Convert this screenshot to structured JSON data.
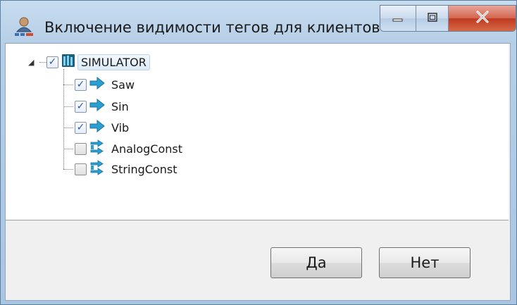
{
  "window": {
    "title": "Включение видимости тегов для клиентов",
    "app_icon": "user-network-icon",
    "controls": {
      "minimize_icon": "minimize-icon",
      "maximize_icon": "maximize-icon",
      "close_icon": "close-icon"
    }
  },
  "tree": {
    "root": {
      "label": "SIMULATOR",
      "checked": true,
      "expanded": true,
      "icon": "server-icon"
    },
    "items": [
      {
        "label": "Saw",
        "checked": true,
        "icon": "arrow-right-icon"
      },
      {
        "label": "Sin",
        "checked": true,
        "icon": "arrow-right-icon"
      },
      {
        "label": "Vib",
        "checked": true,
        "icon": "arrow-right-icon"
      },
      {
        "label": "AnalogConst",
        "checked": false,
        "icon": "double-arrow-icon"
      },
      {
        "label": "StringConst",
        "checked": false,
        "icon": "double-arrow-icon"
      }
    ]
  },
  "buttons": {
    "yes_label": "Да",
    "no_label": "Нет"
  },
  "colors": {
    "frame": "#b6cfe7",
    "close_button": "#c0391f",
    "check_mark": "#2b56b5",
    "tag_icon": "#2a9fd0"
  }
}
